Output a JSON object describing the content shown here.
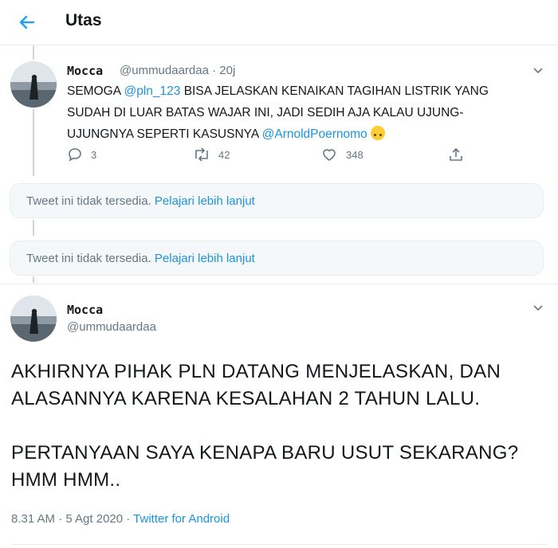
{
  "header": {
    "title": "Utas"
  },
  "reply_tweet": {
    "name": "Mocca",
    "handle": "@ummudaardaa",
    "dot": "·",
    "time": "20j",
    "text_part1": "SEMOGA ",
    "mention1": "@pln_123",
    "text_part2": " BISA JELASKAN KENAIKAN TAGIHAN LISTRIK YANG SUDAH DI LUAR BATAS WAJAR INI, JADI SEDIH AJA KALAU UJUNG-UJUNGNYA SEPERTI KASUSNYA ",
    "mention2": "@ArnoldPoernomo",
    "replies": "3",
    "retweets": "42",
    "likes": "348"
  },
  "unavailable": [
    {
      "text": "Tweet ini tidak tersedia.",
      "link": "Pelajari lebih lanjut"
    },
    {
      "text": "Tweet ini tidak tersedia.",
      "link": "Pelajari lebih lanjut"
    }
  ],
  "main_tweet": {
    "name": "Mocca",
    "handle": "@ummudaardaa",
    "paragraph1": "AKHIRNYA PIHAK PLN DATANG MENJELASKAN, DAN ALASANNYA KARENA KESALAHAN 2 TAHUN LALU.",
    "paragraph2": "PERTANYAAN SAYA KENAPA BARU USUT SEKARANG? HMM HMM..",
    "timestamp": "8.31 AM · 5 Agt 2020 · ",
    "source": "Twitter for Android"
  },
  "colors": {
    "accent": "#1b95e0",
    "muted": "#657786",
    "text": "#14171a",
    "border": "#e6ecf0"
  }
}
